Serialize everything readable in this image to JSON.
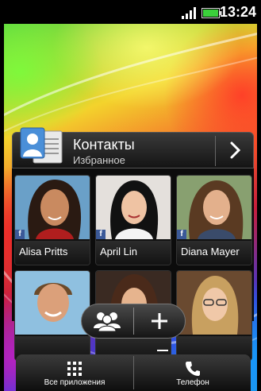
{
  "status_bar": {
    "time": "13:24",
    "icons": [
      "signal-icon",
      "battery-icon"
    ],
    "battery_color": "#3bd03b"
  },
  "contacts_widget": {
    "title": "Контакты",
    "subtitle": "Избранное",
    "icon": "contact-card-icon",
    "open_icon": "chevron-right-icon",
    "favorites": [
      {
        "name": "Alisa Pritts",
        "facebook": true
      },
      {
        "name": "April Lin",
        "facebook": true
      },
      {
        "name": "Diana Mayer",
        "facebook": true
      },
      {
        "name": "",
        "facebook": false
      },
      {
        "name": "",
        "facebook": false
      },
      {
        "name": "",
        "facebook": false
      }
    ],
    "actions": {
      "people_icon": "people-icon",
      "add_icon": "plus-icon"
    }
  },
  "dock": {
    "all_apps_label": "Все приложения",
    "all_apps_icon": "grid-icon",
    "phone_label": "Телефон",
    "phone_icon": "phone-icon"
  }
}
